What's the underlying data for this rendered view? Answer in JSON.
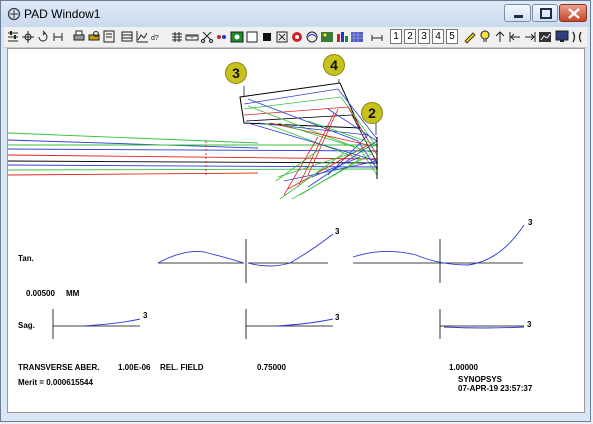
{
  "window": {
    "title": "PAD Window1",
    "icons": {
      "app": "pad-app-icon",
      "min": "minimize-icon",
      "max": "maximize-icon",
      "close": "close-icon"
    }
  },
  "toolbar": {
    "surface_buttons": [
      "1",
      "2",
      "3",
      "4",
      "5"
    ]
  },
  "lens_drawing": {
    "badges": {
      "b3": "3",
      "b4": "4",
      "b2": "2"
    },
    "colors": {
      "blue": "#2b3bd6",
      "green": "#36c23a",
      "red": "#e02020",
      "black": "#000000",
      "badge": "#c8c21c"
    }
  },
  "aberrations": {
    "tan_label": "Tan.",
    "sag_label": "Sag.",
    "scale_value": "0.00500",
    "scale_unit": "MM",
    "curve_label": "3",
    "bottom_left_title": "TRANSVERSE ABER.",
    "wavelength_value": "1.00E-06",
    "rel_field_label": "REL. FIELD",
    "field_values": [
      "0.75000",
      "1.00000"
    ],
    "merit": "Merit = 0.000615544",
    "software": "SYNOPSYS",
    "timestamp": "07-APR-19  23:57:37"
  }
}
